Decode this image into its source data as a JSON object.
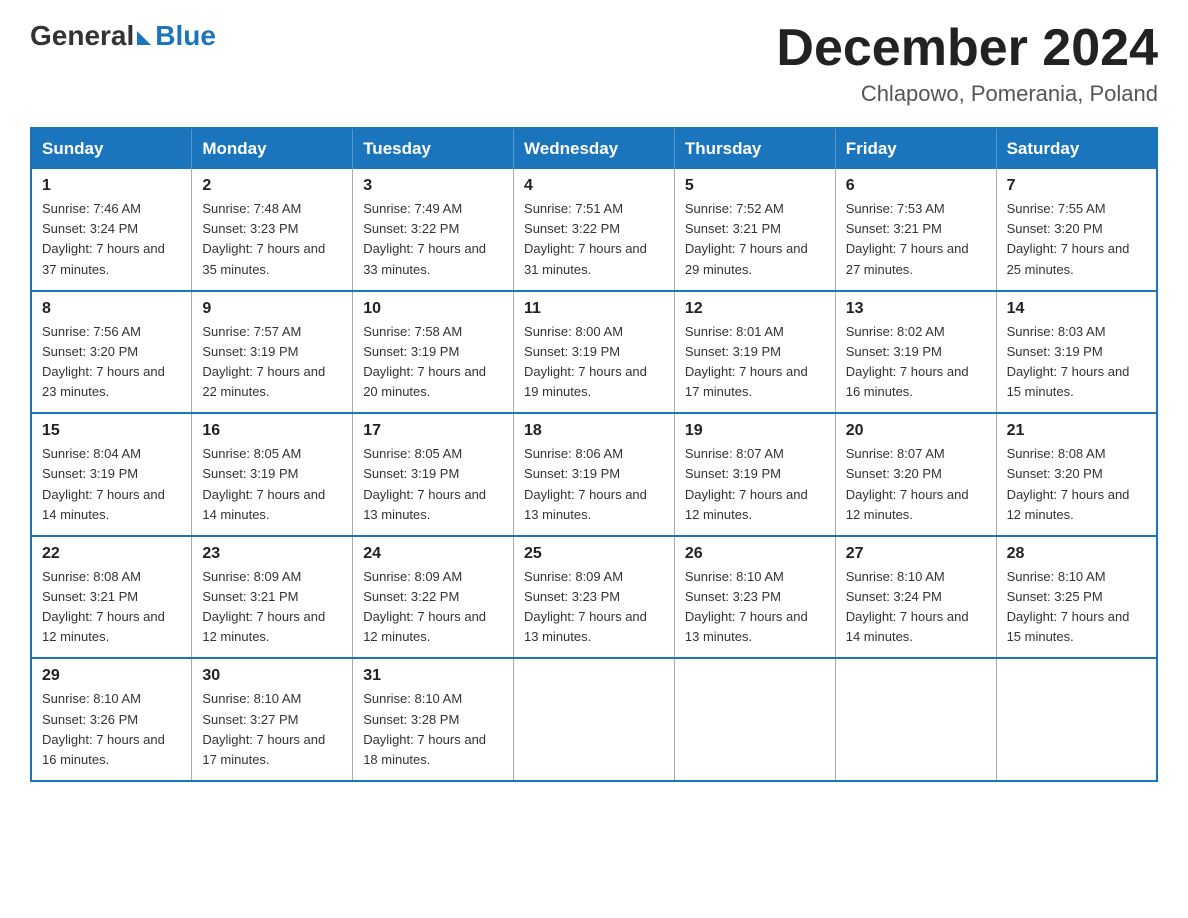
{
  "logo": {
    "general": "General",
    "blue": "Blue"
  },
  "title": "December 2024",
  "subtitle": "Chlapowo, Pomerania, Poland",
  "weekdays": [
    "Sunday",
    "Monday",
    "Tuesday",
    "Wednesday",
    "Thursday",
    "Friday",
    "Saturday"
  ],
  "weeks": [
    [
      {
        "day": "1",
        "sunrise": "7:46 AM",
        "sunset": "3:24 PM",
        "daylight": "7 hours and 37 minutes."
      },
      {
        "day": "2",
        "sunrise": "7:48 AM",
        "sunset": "3:23 PM",
        "daylight": "7 hours and 35 minutes."
      },
      {
        "day": "3",
        "sunrise": "7:49 AM",
        "sunset": "3:22 PM",
        "daylight": "7 hours and 33 minutes."
      },
      {
        "day": "4",
        "sunrise": "7:51 AM",
        "sunset": "3:22 PM",
        "daylight": "7 hours and 31 minutes."
      },
      {
        "day": "5",
        "sunrise": "7:52 AM",
        "sunset": "3:21 PM",
        "daylight": "7 hours and 29 minutes."
      },
      {
        "day": "6",
        "sunrise": "7:53 AM",
        "sunset": "3:21 PM",
        "daylight": "7 hours and 27 minutes."
      },
      {
        "day": "7",
        "sunrise": "7:55 AM",
        "sunset": "3:20 PM",
        "daylight": "7 hours and 25 minutes."
      }
    ],
    [
      {
        "day": "8",
        "sunrise": "7:56 AM",
        "sunset": "3:20 PM",
        "daylight": "7 hours and 23 minutes."
      },
      {
        "day": "9",
        "sunrise": "7:57 AM",
        "sunset": "3:19 PM",
        "daylight": "7 hours and 22 minutes."
      },
      {
        "day": "10",
        "sunrise": "7:58 AM",
        "sunset": "3:19 PM",
        "daylight": "7 hours and 20 minutes."
      },
      {
        "day": "11",
        "sunrise": "8:00 AM",
        "sunset": "3:19 PM",
        "daylight": "7 hours and 19 minutes."
      },
      {
        "day": "12",
        "sunrise": "8:01 AM",
        "sunset": "3:19 PM",
        "daylight": "7 hours and 17 minutes."
      },
      {
        "day": "13",
        "sunrise": "8:02 AM",
        "sunset": "3:19 PM",
        "daylight": "7 hours and 16 minutes."
      },
      {
        "day": "14",
        "sunrise": "8:03 AM",
        "sunset": "3:19 PM",
        "daylight": "7 hours and 15 minutes."
      }
    ],
    [
      {
        "day": "15",
        "sunrise": "8:04 AM",
        "sunset": "3:19 PM",
        "daylight": "7 hours and 14 minutes."
      },
      {
        "day": "16",
        "sunrise": "8:05 AM",
        "sunset": "3:19 PM",
        "daylight": "7 hours and 14 minutes."
      },
      {
        "day": "17",
        "sunrise": "8:05 AM",
        "sunset": "3:19 PM",
        "daylight": "7 hours and 13 minutes."
      },
      {
        "day": "18",
        "sunrise": "8:06 AM",
        "sunset": "3:19 PM",
        "daylight": "7 hours and 13 minutes."
      },
      {
        "day": "19",
        "sunrise": "8:07 AM",
        "sunset": "3:19 PM",
        "daylight": "7 hours and 12 minutes."
      },
      {
        "day": "20",
        "sunrise": "8:07 AM",
        "sunset": "3:20 PM",
        "daylight": "7 hours and 12 minutes."
      },
      {
        "day": "21",
        "sunrise": "8:08 AM",
        "sunset": "3:20 PM",
        "daylight": "7 hours and 12 minutes."
      }
    ],
    [
      {
        "day": "22",
        "sunrise": "8:08 AM",
        "sunset": "3:21 PM",
        "daylight": "7 hours and 12 minutes."
      },
      {
        "day": "23",
        "sunrise": "8:09 AM",
        "sunset": "3:21 PM",
        "daylight": "7 hours and 12 minutes."
      },
      {
        "day": "24",
        "sunrise": "8:09 AM",
        "sunset": "3:22 PM",
        "daylight": "7 hours and 12 minutes."
      },
      {
        "day": "25",
        "sunrise": "8:09 AM",
        "sunset": "3:23 PM",
        "daylight": "7 hours and 13 minutes."
      },
      {
        "day": "26",
        "sunrise": "8:10 AM",
        "sunset": "3:23 PM",
        "daylight": "7 hours and 13 minutes."
      },
      {
        "day": "27",
        "sunrise": "8:10 AM",
        "sunset": "3:24 PM",
        "daylight": "7 hours and 14 minutes."
      },
      {
        "day": "28",
        "sunrise": "8:10 AM",
        "sunset": "3:25 PM",
        "daylight": "7 hours and 15 minutes."
      }
    ],
    [
      {
        "day": "29",
        "sunrise": "8:10 AM",
        "sunset": "3:26 PM",
        "daylight": "7 hours and 16 minutes."
      },
      {
        "day": "30",
        "sunrise": "8:10 AM",
        "sunset": "3:27 PM",
        "daylight": "7 hours and 17 minutes."
      },
      {
        "day": "31",
        "sunrise": "8:10 AM",
        "sunset": "3:28 PM",
        "daylight": "7 hours and 18 minutes."
      },
      null,
      null,
      null,
      null
    ]
  ]
}
